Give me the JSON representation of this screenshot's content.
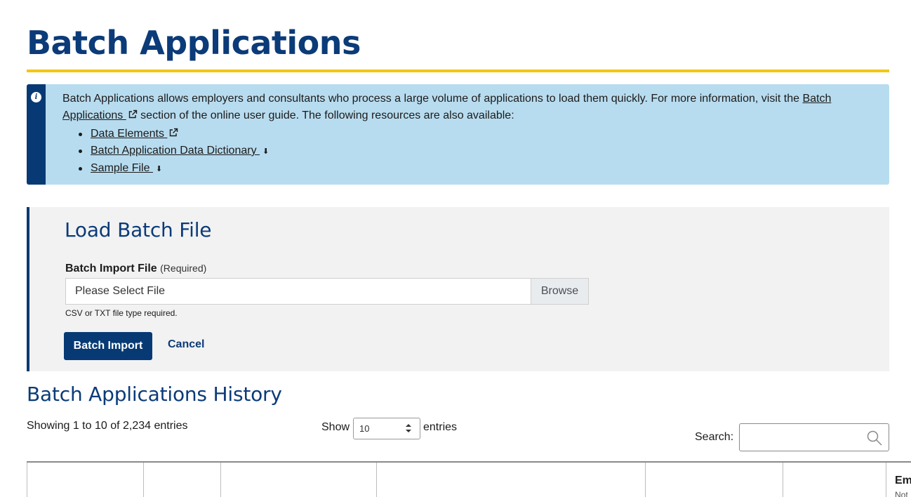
{
  "page": {
    "title": "Batch Applications"
  },
  "info": {
    "text_before": "Batch Applications allows employers and consultants who process a large volume of applications to load them quickly. For more information, visit the ",
    "link_label": "Batch Applications ",
    "text_after": " section of the online user guide. The following resources are also available:",
    "resources": [
      {
        "label": "Data Elements ",
        "icon": "external-link-icon"
      },
      {
        "label": "Batch Application Data Dictionary ",
        "icon": "download-icon"
      },
      {
        "label": "Sample File ",
        "icon": "download-icon"
      }
    ]
  },
  "load": {
    "title": "Load Batch File",
    "field_label": "Batch Import File",
    "field_required": "(Required)",
    "file_placeholder": "Please Select File",
    "browse_label": "Browse",
    "help": "CSV or TXT file type required.",
    "import_label": "Batch Import",
    "cancel_label": "Cancel"
  },
  "history": {
    "title": "Batch Applications History",
    "showing": "Showing 1 to 10 of 2,234 entries",
    "show_label": "Show",
    "page_size": "10",
    "entries_label": "entries",
    "search_label": "Search:",
    "search_value": "",
    "partial_column_label": "Em",
    "partial_column_sub": "Not"
  },
  "colors": {
    "primary": "#0b3b78",
    "accent": "#f2c80f",
    "info_bg": "#b8dcef",
    "panel_bg": "#f2f2f2"
  }
}
